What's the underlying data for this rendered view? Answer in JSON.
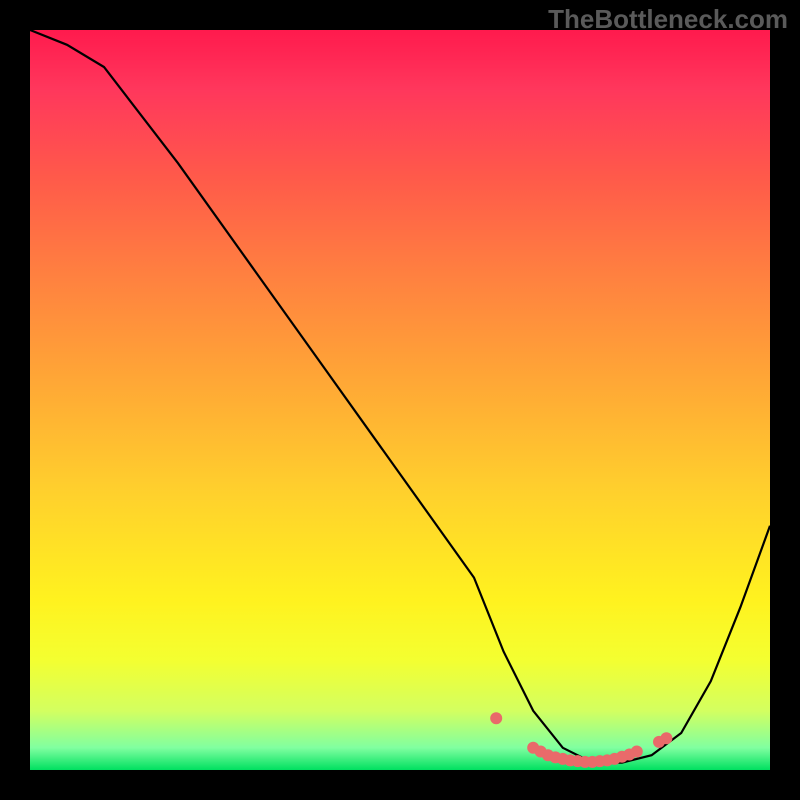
{
  "watermark": "TheBottleneck.com",
  "chart_data": {
    "type": "line",
    "title": "",
    "xlabel": "",
    "ylabel": "",
    "xlim": [
      0,
      100
    ],
    "ylim": [
      0,
      100
    ],
    "gradient_colors": [
      "#ff1a4d",
      "#ffa636",
      "#fff21f",
      "#00e060"
    ],
    "series": [
      {
        "name": "bottleneck-curve",
        "x": [
          0,
          5,
          10,
          20,
          30,
          40,
          50,
          60,
          64,
          68,
          72,
          76,
          80,
          84,
          88,
          92,
          96,
          100
        ],
        "values": [
          100,
          98,
          95,
          82,
          68,
          54,
          40,
          26,
          16,
          8,
          3,
          1,
          1,
          2,
          5,
          12,
          22,
          33
        ]
      },
      {
        "name": "highlight-dots",
        "x": [
          63,
          68,
          69,
          70,
          71,
          72,
          73,
          74,
          75,
          76,
          77,
          78,
          79,
          80,
          81,
          82,
          85,
          86
        ],
        "values": [
          7,
          3,
          2.5,
          2,
          1.7,
          1.5,
          1.3,
          1.2,
          1.1,
          1.1,
          1.2,
          1.3,
          1.5,
          1.8,
          2.1,
          2.5,
          3.8,
          4.3
        ]
      }
    ]
  }
}
